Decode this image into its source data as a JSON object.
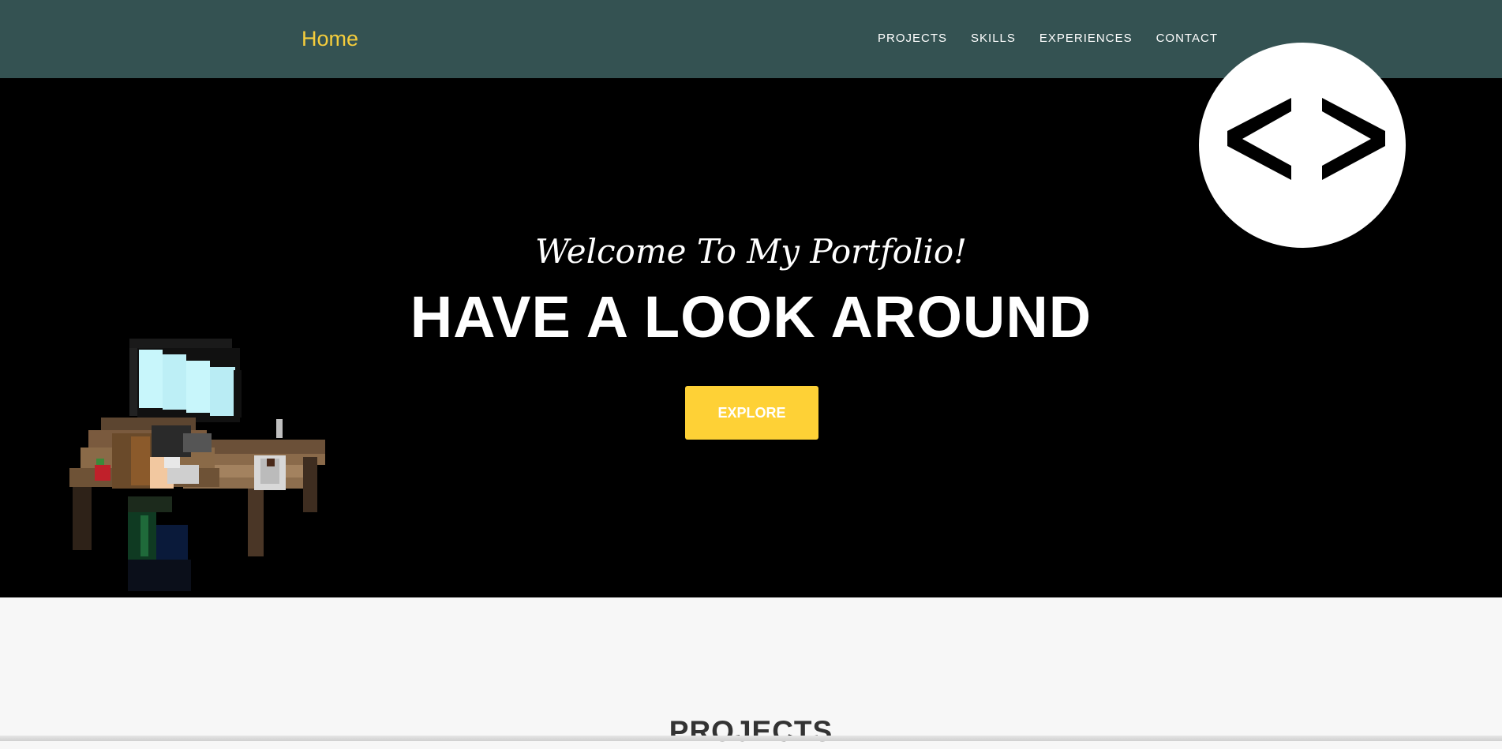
{
  "navbar": {
    "brand": "Home",
    "links": [
      {
        "label": "PROJECTS"
      },
      {
        "label": "SKILLS"
      },
      {
        "label": "EXPERIENCES"
      },
      {
        "label": "CONTACT"
      }
    ]
  },
  "hero": {
    "welcome": "Welcome To My Portfolio!",
    "headline": "HAVE A LOOK AROUND",
    "explore_label": "EXPLORE"
  },
  "sections": {
    "projects_title": "PROJECTS"
  },
  "icons": {
    "logo": "code-brackets-icon",
    "illustration": "pixel-art-programmer-at-desk"
  },
  "colors": {
    "navbar_bg": "#345252",
    "brand": "#f5cd3c",
    "hero_bg": "#000000",
    "button_bg": "#fed136",
    "section_bg": "#f7f7f7",
    "heading_dark": "#333333"
  }
}
